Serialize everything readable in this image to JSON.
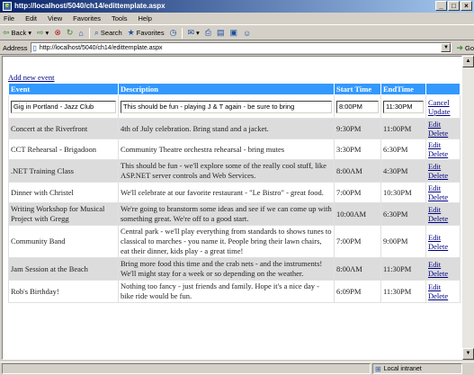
{
  "window": {
    "title": "http://localhost/5040/ch14/edittemplate.aspx"
  },
  "menu": [
    "File",
    "Edit",
    "View",
    "Favorites",
    "Tools",
    "Help"
  ],
  "toolbar": {
    "back": "Back",
    "forward": "",
    "search": "Search",
    "favorites": "Favorites"
  },
  "address": {
    "label": "Address",
    "url": "http://localhost/5040/ch14/edittemplate.aspx",
    "go": "Go"
  },
  "status": {
    "main": "",
    "zone": "Local intranet"
  },
  "page": {
    "add_link": "Add new event",
    "headers": {
      "event": "Event",
      "description": "Description",
      "start": "Start Time",
      "end": "EndTime",
      "actions": ""
    },
    "edit_row": {
      "event": "Gig in Portland - Jazz Club",
      "description": "This should be fun - playing J & T again - be sure to bring",
      "start": "8:00PM",
      "end": "11:30PM",
      "cancel": "Cancel",
      "update": "Update"
    },
    "rows": [
      {
        "event": "Concert at the Riverfront",
        "description": "4th of July celebration. Bring stand and a jacket.",
        "start": "9:30PM",
        "end": "11:00PM",
        "edit": "Edit",
        "delete": "Delete"
      },
      {
        "event": "CCT Rehearsal - Brigadoon",
        "description": "Community Theatre orchestra rehearsal - bring mutes",
        "start": "3:30PM",
        "end": "6:30PM",
        "edit": "Edit",
        "delete": "Delete"
      },
      {
        "event": ".NET Training Class",
        "description": "This should be fun - we'll explore some of the really cool stuff, like ASP.NET server controls and Web Services.",
        "start": "8:00AM",
        "end": "4:30PM",
        "edit": "Edit",
        "delete": "Delete"
      },
      {
        "event": "Dinner with Christel",
        "description": "We'll celebrate at our favorite restaurant - \"Le Bistro\" - great food.",
        "start": "7:00PM",
        "end": "10:30PM",
        "edit": "Edit",
        "delete": "Delete"
      },
      {
        "event": "Writing Workshop for Musical Project with Gregg",
        "description": "We're going to branstorm some ideas and see if we can come up with something great. We're off to a good start.",
        "start": "10:00AM",
        "end": "6:30PM",
        "edit": "Edit",
        "delete": "Delete"
      },
      {
        "event": "Community Band",
        "description": "Central park - we'll play everything from standards to shows tunes to classical to marches - you name it. People bring their lawn chairs, eat their dinner, kids play - a great time!",
        "start": "7:00PM",
        "end": "9:00PM",
        "edit": "Edit",
        "delete": "Delete"
      },
      {
        "event": "Jam Session at the Beach",
        "description": "Bring more food this time and the crab nets - and the instruments! We'll might stay for a week or so depending on the weather.",
        "start": "8:00AM",
        "end": "11:30PM",
        "edit": "Edit",
        "delete": "Delete"
      },
      {
        "event": "Rob's Birthday!",
        "description": "Nothing too fancy - just friends and family. Hope it's a nice day - bike ride would be fun.",
        "start": "6:09PM",
        "end": "11:30PM",
        "edit": "Edit",
        "delete": "Delete"
      }
    ]
  }
}
